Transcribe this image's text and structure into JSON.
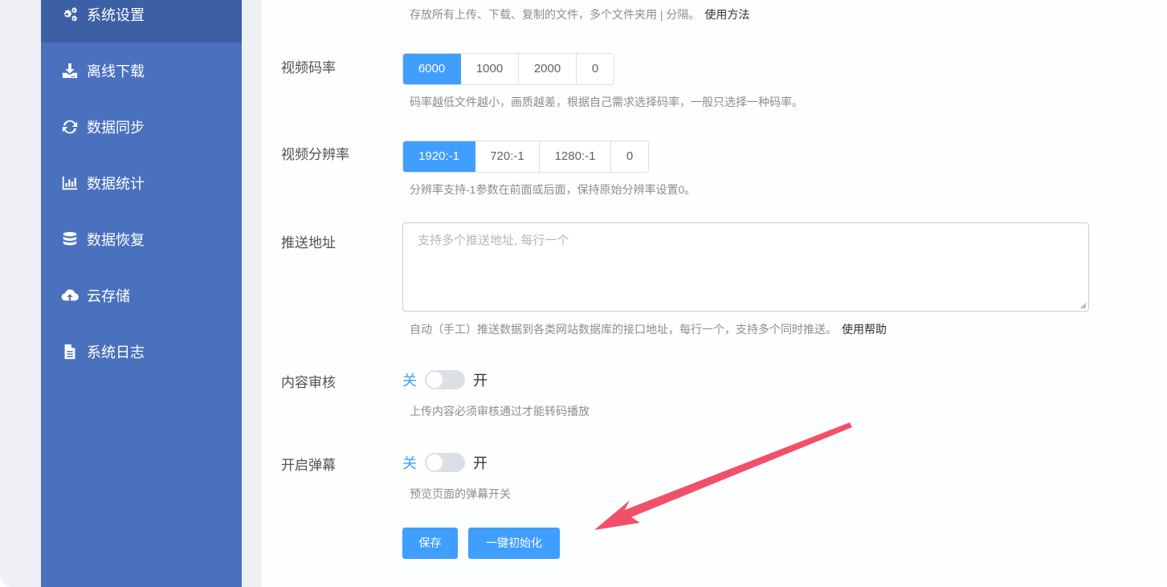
{
  "sidebar": {
    "items": [
      {
        "label": "系统设置",
        "icon": "gears-icon"
      },
      {
        "label": "离线下载",
        "icon": "download-icon"
      },
      {
        "label": "数据同步",
        "icon": "sync-icon"
      },
      {
        "label": "数据统计",
        "icon": "bar-chart-icon"
      },
      {
        "label": "数据恢复",
        "icon": "database-icon"
      },
      {
        "label": "云存储",
        "icon": "cloud-upload-icon"
      },
      {
        "label": "系统日志",
        "icon": "file-icon"
      }
    ]
  },
  "top_hint": {
    "text": "存放所有上传、下载、复制的文件，多个文件夹用 | 分隔。",
    "link": "使用方法"
  },
  "bitrate": {
    "label": "视频码率",
    "options": [
      "6000",
      "1000",
      "2000",
      "0"
    ],
    "selected": "6000",
    "hint": "码率越低文件越小，画质越差，根据自己需求选择码率，一般只选择一种码率。"
  },
  "resolution": {
    "label": "视频分辨率",
    "options": [
      "1920:-1",
      "720:-1",
      "1280:-1",
      "0"
    ],
    "selected": "1920:-1",
    "hint": "分辨率支持-1参数在前面或后面，保持原始分辨率设置0。"
  },
  "push": {
    "label": "推送地址",
    "placeholder": "支持多个推送地址, 每行一个",
    "hint": "自动（手工）推送数据到各类网站数据库的接口地址，每行一个，支持多个同时推送。",
    "link": "使用帮助"
  },
  "review": {
    "label": "内容审核",
    "off_text": "关",
    "on_text": "开",
    "value": false,
    "hint": "上传内容必须审核通过才能转码播放"
  },
  "danmaku": {
    "label": "开启弹幕",
    "off_text": "关",
    "on_text": "开",
    "value": false,
    "hint": "预览页面的弹幕开关"
  },
  "actions": {
    "save": "保存",
    "reset": "一键初始化"
  },
  "colors": {
    "sidebar": "#4a71be",
    "sidebar_active": "#3d5fa6",
    "primary": "#409eff",
    "annotation_arrow": "#f2506a"
  }
}
